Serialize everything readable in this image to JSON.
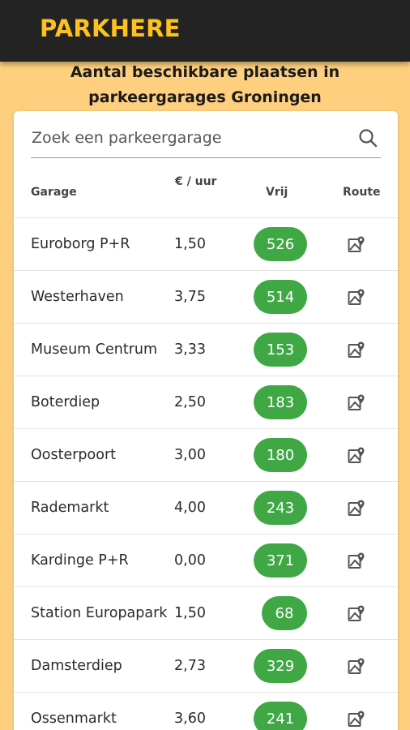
{
  "app": {
    "title": "PARKHERE"
  },
  "heading": {
    "line1": "Aantal beschikbare plaatsen in",
    "line2": "parkeergarages Groningen"
  },
  "search": {
    "placeholder": "Zoek een parkeergarage",
    "icon": "search-icon"
  },
  "table": {
    "columns": [
      "Garage",
      "€ / uur",
      "Vrij",
      "Route"
    ],
    "rows": [
      {
        "name": "Euroborg P+R",
        "price": "1,50",
        "free": "526"
      },
      {
        "name": "Westerhaven",
        "price": "3,75",
        "free": "514"
      },
      {
        "name": "Museum Centrum",
        "price": "3,33",
        "free": "153"
      },
      {
        "name": "Boterdiep",
        "price": "2,50",
        "free": "183"
      },
      {
        "name": "Oosterpoort",
        "price": "3,00",
        "free": "180"
      },
      {
        "name": "Rademarkt",
        "price": "4,00",
        "free": "243"
      },
      {
        "name": "Kardinge P+R",
        "price": "0,00",
        "free": "371"
      },
      {
        "name": "Station Europapark",
        "price": "1,50",
        "free": "68"
      },
      {
        "name": "Damsterdiep",
        "price": "2,73",
        "free": "329"
      },
      {
        "name": "Ossenmarkt",
        "price": "3,60",
        "free": "241"
      }
    ]
  },
  "colors": {
    "topbar": "#232323",
    "logo": "#ffc11e",
    "background": "#fdcf7e",
    "free_badge": "#3fa845"
  }
}
